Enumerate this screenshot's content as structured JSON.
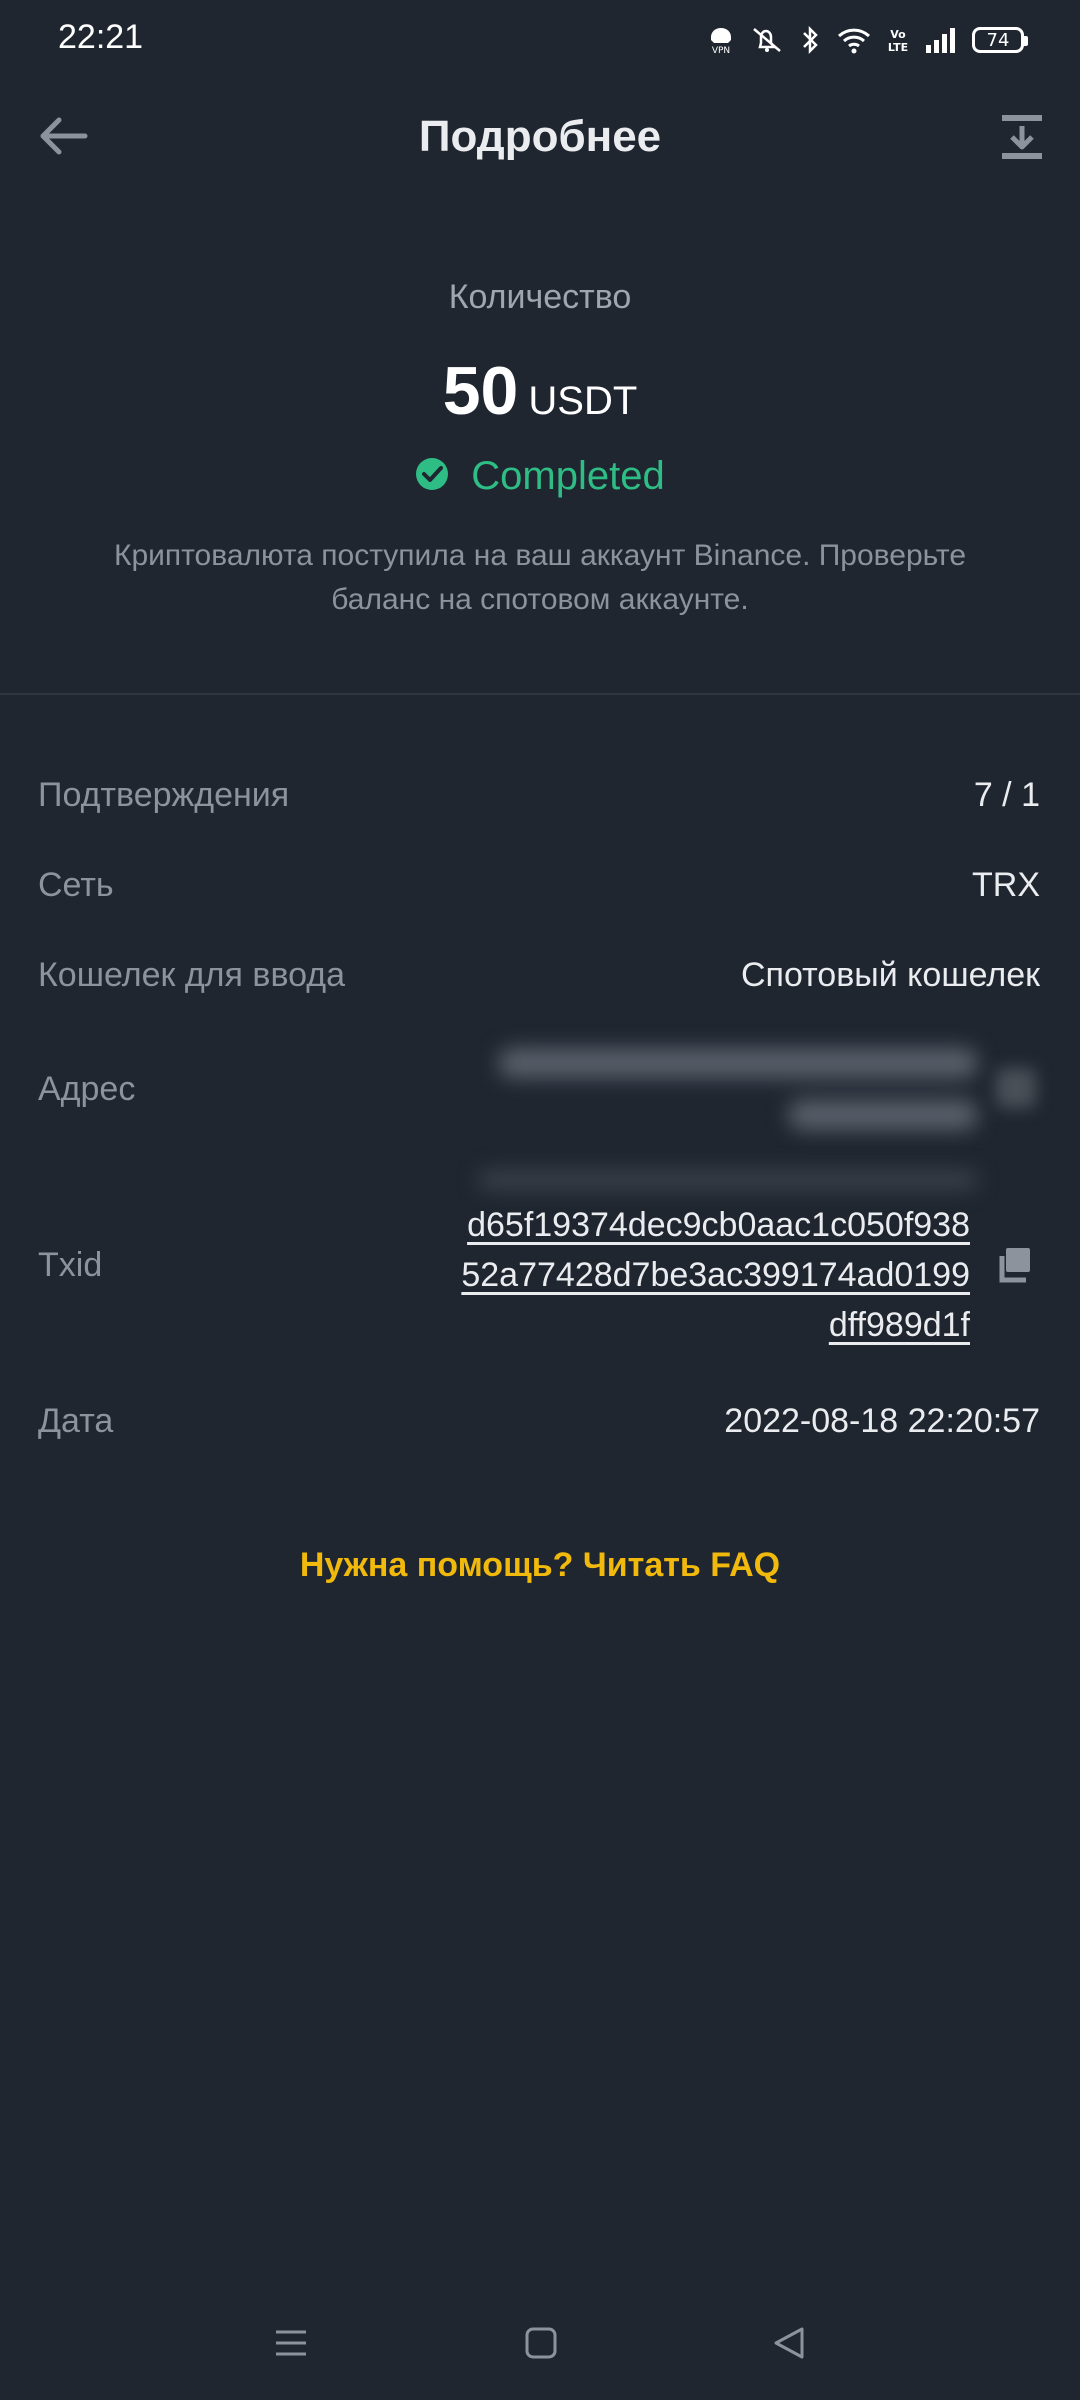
{
  "status_bar": {
    "time": "22:21",
    "battery": "74",
    "icons": [
      "vpn-icon",
      "mute-icon",
      "bluetooth-icon",
      "wifi-icon",
      "volte-icon",
      "signal-icon",
      "battery-icon"
    ]
  },
  "header": {
    "title": "Подробнее",
    "back_icon": "arrow-left-icon",
    "share_icon": "download-share-icon"
  },
  "summary": {
    "quantity_label": "Количество",
    "amount": "50",
    "unit": "USDT",
    "status": "Completed",
    "status_color": "#2ebd85",
    "description": "Криптовалюта поступила на ваш аккаунт Binance. Проверьте баланс на спотовом аккаунте."
  },
  "details": {
    "confirmations_label": "Подтверждения",
    "confirmations_value": "7 / 1",
    "network_label": "Сеть",
    "network_value": "TRX",
    "wallet_label": "Кошелек для ввода",
    "wallet_value": "Спотовый кошелек",
    "address_label": "Адрес",
    "txid_label": "Txid",
    "txid_value": "d65f19374dec9cb0aac1c050f93852a77428d7be3ac399174ad0199dff989d1f",
    "date_label": "Дата",
    "date_value": "2022-08-18 22:20:57"
  },
  "help": {
    "faq_label": "Нужна помощь? Читать FAQ",
    "faq_color": "#f0b90b"
  },
  "nav_bar": {
    "icons": [
      "menu-icon",
      "home-icon",
      "back-triangle-icon"
    ]
  }
}
